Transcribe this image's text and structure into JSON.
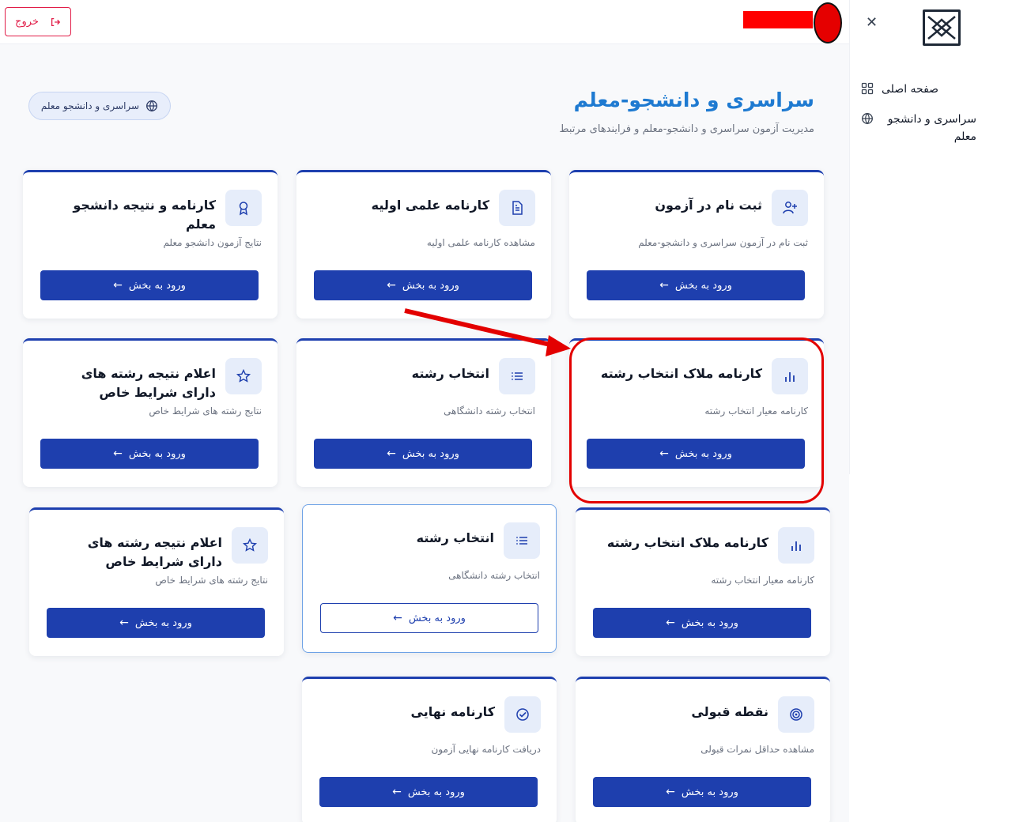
{
  "topbar": {
    "logout_label": "خروج"
  },
  "sidebar": {
    "items": [
      {
        "label": "صفحه اصلی",
        "icon": "grid-icon"
      },
      {
        "label": "سراسری و دانشجو معلم",
        "icon": "globe-icon"
      }
    ]
  },
  "header": {
    "title": "سراسری و دانشجو-معلم",
    "subtitle": "مدیریت آزمون سراسری و دانشجو-معلم و فرایندهای مرتبط",
    "chip_label": "سراسری و دانشجو معلم"
  },
  "cards": [
    {
      "title": "ثبت نام در آزمون",
      "desc": "ثبت نام در آزمون سراسری و دانشجو-معلم",
      "button": "ورود به بخش",
      "icon": "user-plus-icon"
    },
    {
      "title": "کارنامه علمی اولیه",
      "desc": "مشاهده کارنامه علمی اولیه",
      "button": "ورود به بخش",
      "icon": "document-icon"
    },
    {
      "title": "کارنامه و نتیجه دانشجو معلم",
      "desc": "نتایج آزمون دانشجو معلم",
      "button": "ورود به بخش",
      "icon": "award-icon"
    },
    {
      "title": "کارنامه ملاک انتخاب رشته",
      "desc": "کارنامه معیار انتخاب رشته",
      "button": "ورود به بخش",
      "icon": "bar-chart-icon"
    },
    {
      "title": "انتخاب رشته",
      "desc": "انتخاب رشته دانشگاهی",
      "button": "ورود به بخش",
      "icon": "list-icon"
    },
    {
      "title": "اعلام نتیجه رشته های دارای شرایط خاص",
      "desc": "نتایج رشته های شرایط خاص",
      "button": "ورود به بخش",
      "icon": "star-icon"
    },
    {
      "title": "کارنامه ملاک انتخاب رشته",
      "desc": "کارنامه معیار انتخاب رشته",
      "button": "ورود به بخش",
      "icon": "bar-chart-icon"
    },
    {
      "title": "انتخاب رشته",
      "desc": "انتخاب رشته دانشگاهی",
      "button": "ورود به بخش",
      "icon": "list-icon"
    },
    {
      "title": "اعلام نتیجه رشته های دارای شرایط خاص",
      "desc": "نتایج رشته های شرایط خاص",
      "button": "ورود به بخش",
      "icon": "star-icon"
    },
    {
      "title": "نقطه قبولی",
      "desc": "مشاهده حداقل نمرات قبولی",
      "button": "ورود به بخش",
      "icon": "target-icon"
    },
    {
      "title": "کارنامه نهایی",
      "desc": "دریافت کارنامه نهایی آزمون",
      "button": "ورود به بخش",
      "icon": "check-circle-icon"
    }
  ]
}
